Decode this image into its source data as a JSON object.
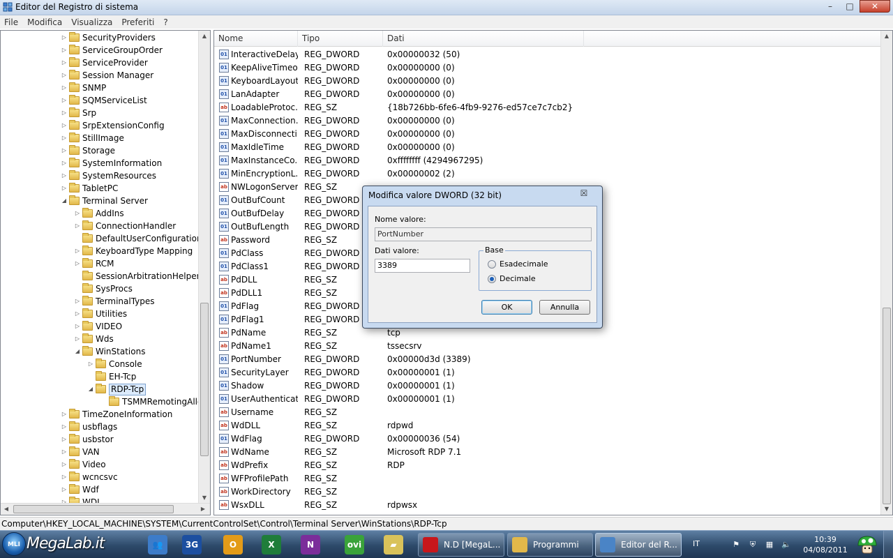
{
  "window": {
    "title": "Editor del Registro di sistema",
    "minimize": "–",
    "maximize": "□",
    "close": "✕"
  },
  "menu": [
    "File",
    "Modifica",
    "Visualizza",
    "Preferiti",
    "?"
  ],
  "tree": [
    {
      "label": "SecurityProviders",
      "level": 0,
      "exp": "▷"
    },
    {
      "label": "ServiceGroupOrder",
      "level": 0,
      "exp": "▷"
    },
    {
      "label": "ServiceProvider",
      "level": 0,
      "exp": "▷"
    },
    {
      "label": "Session Manager",
      "level": 0,
      "exp": "▷"
    },
    {
      "label": "SNMP",
      "level": 0,
      "exp": "▷"
    },
    {
      "label": "SQMServiceList",
      "level": 0,
      "exp": "▷"
    },
    {
      "label": "Srp",
      "level": 0,
      "exp": "▷"
    },
    {
      "label": "SrpExtensionConfig",
      "level": 0,
      "exp": "▷"
    },
    {
      "label": "StillImage",
      "level": 0,
      "exp": "▷"
    },
    {
      "label": "Storage",
      "level": 0,
      "exp": "▷"
    },
    {
      "label": "SystemInformation",
      "level": 0,
      "exp": "▷"
    },
    {
      "label": "SystemResources",
      "level": 0,
      "exp": "▷"
    },
    {
      "label": "TabletPC",
      "level": 0,
      "exp": "▷"
    },
    {
      "label": "Terminal Server",
      "level": 0,
      "exp": "◢"
    },
    {
      "label": "AddIns",
      "level": 1,
      "exp": "▷"
    },
    {
      "label": "ConnectionHandler",
      "level": 1,
      "exp": "▷"
    },
    {
      "label": "DefaultUserConfiguration",
      "level": 1,
      "exp": ""
    },
    {
      "label": "KeyboardType Mapping",
      "level": 1,
      "exp": "▷"
    },
    {
      "label": "RCM",
      "level": 1,
      "exp": "▷"
    },
    {
      "label": "SessionArbitrationHelper",
      "level": 1,
      "exp": ""
    },
    {
      "label": "SysProcs",
      "level": 1,
      "exp": ""
    },
    {
      "label": "TerminalTypes",
      "level": 1,
      "exp": "▷"
    },
    {
      "label": "Utilities",
      "level": 1,
      "exp": "▷"
    },
    {
      "label": "VIDEO",
      "level": 1,
      "exp": "▷"
    },
    {
      "label": "Wds",
      "level": 1,
      "exp": "▷"
    },
    {
      "label": "WinStations",
      "level": 1,
      "exp": "◢"
    },
    {
      "label": "Console",
      "level": 2,
      "exp": "▷"
    },
    {
      "label": "EH-Tcp",
      "level": 2,
      "exp": ""
    },
    {
      "label": "RDP-Tcp",
      "level": 2,
      "exp": "◢",
      "selected": true
    },
    {
      "label": "TSMMRemotingAllo",
      "level": 3,
      "exp": ""
    },
    {
      "label": "TimeZoneInformation",
      "level": 0,
      "exp": "▷"
    },
    {
      "label": "usbflags",
      "level": 0,
      "exp": "▷"
    },
    {
      "label": "usbstor",
      "level": 0,
      "exp": "▷"
    },
    {
      "label": "VAN",
      "level": 0,
      "exp": "▷"
    },
    {
      "label": "Video",
      "level": 0,
      "exp": "▷"
    },
    {
      "label": "wcncsvc",
      "level": 0,
      "exp": "▷"
    },
    {
      "label": "Wdf",
      "level": 0,
      "exp": "▷"
    },
    {
      "label": "WDI",
      "level": 0,
      "exp": "▷"
    }
  ],
  "list": {
    "columns": [
      "Nome",
      "Tipo",
      "Dati"
    ],
    "rows": [
      {
        "name": "InteractiveDelay",
        "type": "REG_DWORD",
        "data": "0x00000032 (50)"
      },
      {
        "name": "KeepAliveTimeo...",
        "type": "REG_DWORD",
        "data": "0x00000000 (0)"
      },
      {
        "name": "KeyboardLayout",
        "type": "REG_DWORD",
        "data": "0x00000000 (0)"
      },
      {
        "name": "LanAdapter",
        "type": "REG_DWORD",
        "data": "0x00000000 (0)"
      },
      {
        "name": "LoadableProtoc...",
        "type": "REG_SZ",
        "data": "{18b726bb-6fe6-4fb9-9276-ed57ce7c7cb2}"
      },
      {
        "name": "MaxConnection...",
        "type": "REG_DWORD",
        "data": "0x00000000 (0)"
      },
      {
        "name": "MaxDisconnecti...",
        "type": "REG_DWORD",
        "data": "0x00000000 (0)"
      },
      {
        "name": "MaxIdleTime",
        "type": "REG_DWORD",
        "data": "0x00000000 (0)"
      },
      {
        "name": "MaxInstanceCo...",
        "type": "REG_DWORD",
        "data": "0xffffffff (4294967295)"
      },
      {
        "name": "MinEncryptionL...",
        "type": "REG_DWORD",
        "data": "0x00000002 (2)"
      },
      {
        "name": "NWLogonServer",
        "type": "REG_SZ",
        "data": ""
      },
      {
        "name": "OutBufCount",
        "type": "REG_DWORD",
        "data": ""
      },
      {
        "name": "OutBufDelay",
        "type": "REG_DWORD",
        "data": ""
      },
      {
        "name": "OutBufLength",
        "type": "REG_DWORD",
        "data": ""
      },
      {
        "name": "Password",
        "type": "REG_SZ",
        "data": ""
      },
      {
        "name": "PdClass",
        "type": "REG_DWORD",
        "data": ""
      },
      {
        "name": "PdClass1",
        "type": "REG_DWORD",
        "data": ""
      },
      {
        "name": "PdDLL",
        "type": "REG_SZ",
        "data": ""
      },
      {
        "name": "PdDLL1",
        "type": "REG_SZ",
        "data": ""
      },
      {
        "name": "PdFlag",
        "type": "REG_DWORD",
        "data": ""
      },
      {
        "name": "PdFlag1",
        "type": "REG_DWORD",
        "data": ""
      },
      {
        "name": "PdName",
        "type": "REG_SZ",
        "data": "tcp"
      },
      {
        "name": "PdName1",
        "type": "REG_SZ",
        "data": "tssecsrv"
      },
      {
        "name": "PortNumber",
        "type": "REG_DWORD",
        "data": "0x00000d3d (3389)"
      },
      {
        "name": "SecurityLayer",
        "type": "REG_DWORD",
        "data": "0x00000001 (1)"
      },
      {
        "name": "Shadow",
        "type": "REG_DWORD",
        "data": "0x00000001 (1)"
      },
      {
        "name": "UserAuthenticat...",
        "type": "REG_DWORD",
        "data": "0x00000001 (1)"
      },
      {
        "name": "Username",
        "type": "REG_SZ",
        "data": ""
      },
      {
        "name": "WdDLL",
        "type": "REG_SZ",
        "data": "rdpwd"
      },
      {
        "name": "WdFlag",
        "type": "REG_DWORD",
        "data": "0x00000036 (54)"
      },
      {
        "name": "WdName",
        "type": "REG_SZ",
        "data": "Microsoft RDP 7.1"
      },
      {
        "name": "WdPrefix",
        "type": "REG_SZ",
        "data": "RDP"
      },
      {
        "name": "WFProfilePath",
        "type": "REG_SZ",
        "data": ""
      },
      {
        "name": "WorkDirectory",
        "type": "REG_SZ",
        "data": ""
      },
      {
        "name": "WsxDLL",
        "type": "REG_SZ",
        "data": "rdpwsx"
      }
    ]
  },
  "statusbar": {
    "path": "Computer\\HKEY_LOCAL_MACHINE\\SYSTEM\\CurrentControlSet\\Control\\Terminal Server\\WinStations\\RDP-Tcp"
  },
  "dialog": {
    "title": "Modifica valore DWORD (32 bit)",
    "close": "☒",
    "name_label": "Nome valore:",
    "name_value": "PortNumber",
    "data_label": "Dati valore:",
    "data_value": "3389",
    "base_label": "Base",
    "hex_label": "Esadecimale",
    "dec_label": "Decimale",
    "selected_base": "Decimale",
    "ok": "OK",
    "cancel": "Annulla"
  },
  "taskbar": {
    "start": "MLI",
    "brand": "MegaLab.it",
    "pinned": [
      {
        "name": "users-icon",
        "glyph": "👥",
        "color": "#3d7cc9"
      },
      {
        "name": "3g-icon",
        "glyph": "3G",
        "color": "#1c4fa0"
      },
      {
        "name": "outlook-icon",
        "glyph": "O",
        "color": "#e39b18"
      },
      {
        "name": "excel-icon",
        "glyph": "X",
        "color": "#1f7d3a"
      },
      {
        "name": "onenote-icon",
        "glyph": "N",
        "color": "#7b2d9a"
      },
      {
        "name": "ovi-icon",
        "glyph": "ovi",
        "color": "#3aa33a"
      },
      {
        "name": "folders-icon",
        "glyph": "▰",
        "color": "#d9c25a"
      }
    ],
    "tasks": [
      {
        "label": "N.D [MegaL...",
        "color": "#c8171b"
      },
      {
        "label": "Programmi",
        "color": "#e2b84a"
      },
      {
        "label": "Editor del R...",
        "color": "#4a84c6"
      }
    ],
    "lang": "IT",
    "time": "10:39",
    "date": "04/08/2011"
  }
}
